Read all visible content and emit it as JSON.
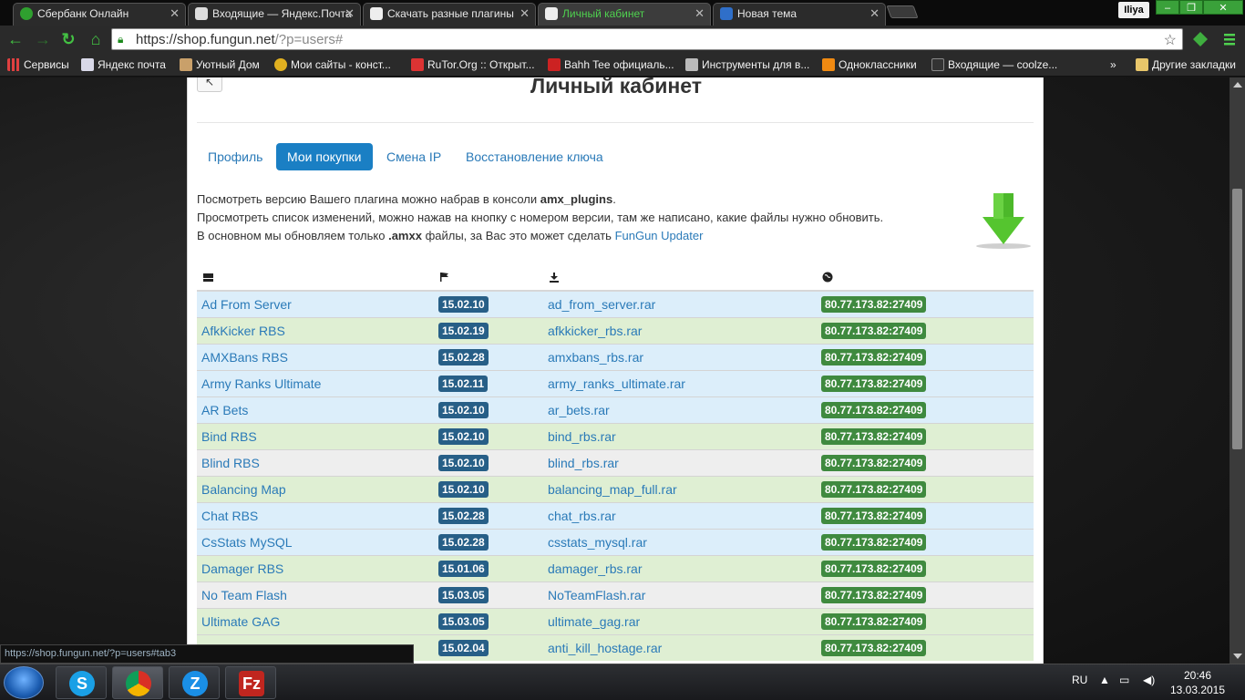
{
  "browser": {
    "tabs": [
      {
        "title": "Сбербанк Онлайн",
        "active": false
      },
      {
        "title": "Входящие — Яндекс.Почта",
        "active": false
      },
      {
        "title": "Скачать разные плагины",
        "active": false
      },
      {
        "title": "Личный кабинет",
        "active": true
      },
      {
        "title": "Новая тема",
        "active": false
      }
    ],
    "user": "Iliya",
    "url_main": "https://shop.fungun.net",
    "url_rest": "/?p=users#",
    "bookmarks": [
      "Сервисы",
      "Яндекс почта",
      "Уютный Дом",
      "Мои сайты - конст...",
      "RuTor.Org :: Открыт...",
      "Bahh Tee официаль...",
      "Инструменты для в...",
      "Одноклассники",
      "Входящие — coolze..."
    ],
    "bookmarks_more": "»",
    "other_bookmarks": "Другие закладки",
    "status_url": "https://shop.fungun.net/?p=users#tab3"
  },
  "page": {
    "title": "Личный кабинет",
    "tabs": [
      "Профиль",
      "Мои покупки",
      "Смена IP",
      "Восстановление ключа"
    ],
    "info": {
      "l1_a": "Посмотреть версию Вашего плагина можно набрав в консоли ",
      "l1_b": "amx_plugins",
      "l1_c": ".",
      "l2": "Просмотреть список изменений, можно нажав на кнопку с номером версии, там же написано, какие файлы нужно обновить.",
      "l3_a": "В основном мы обновляем только ",
      "l3_b": ".amxx",
      "l3_c": " файлы, за Вас это может сделать ",
      "l3_link": "FunGun Updater"
    },
    "table": {
      "header_icons": [
        "server-icon",
        "flag-icon",
        "download-icon",
        "globe-icon"
      ],
      "rows": [
        {
          "name": "Ad From Server",
          "version": "15.02.10",
          "file": "ad_from_server.rar",
          "server": "80.77.173.82:27409",
          "color": "blue"
        },
        {
          "name": "AfkKicker RBS",
          "version": "15.02.19",
          "file": "afkkicker_rbs.rar",
          "server": "80.77.173.82:27409",
          "color": "green"
        },
        {
          "name": "AMXBans RBS",
          "version": "15.02.28",
          "file": "amxbans_rbs.rar",
          "server": "80.77.173.82:27409",
          "color": "blue"
        },
        {
          "name": "Army Ranks Ultimate",
          "version": "15.02.11",
          "file": "army_ranks_ultimate.rar",
          "server": "80.77.173.82:27409",
          "color": "blue"
        },
        {
          "name": "AR Bets",
          "version": "15.02.10",
          "file": "ar_bets.rar",
          "server": "80.77.173.82:27409",
          "color": "blue"
        },
        {
          "name": "Bind RBS",
          "version": "15.02.10",
          "file": "bind_rbs.rar",
          "server": "80.77.173.82:27409",
          "color": "green"
        },
        {
          "name": "Blind RBS",
          "version": "15.02.10",
          "file": "blind_rbs.rar",
          "server": "80.77.173.82:27409",
          "color": "grey"
        },
        {
          "name": "Balancing Map",
          "version": "15.02.10",
          "file": "balancing_map_full.rar",
          "server": "80.77.173.82:27409",
          "color": "green"
        },
        {
          "name": "Chat RBS",
          "version": "15.02.28",
          "file": "chat_rbs.rar",
          "server": "80.77.173.82:27409",
          "color": "blue"
        },
        {
          "name": "CsStats MySQL",
          "version": "15.02.28",
          "file": "csstats_mysql.rar",
          "server": "80.77.173.82:27409",
          "color": "blue"
        },
        {
          "name": "Damager RBS",
          "version": "15.01.06",
          "file": "damager_rbs.rar",
          "server": "80.77.173.82:27409",
          "color": "green"
        },
        {
          "name": "No Team Flash",
          "version": "15.03.05",
          "file": "NoTeamFlash.rar",
          "server": "80.77.173.82:27409",
          "color": "grey"
        },
        {
          "name": "Ultimate GAG",
          "version": "15.03.05",
          "file": "ultimate_gag.rar",
          "server": "80.77.173.82:27409",
          "color": "green"
        },
        {
          "name": "",
          "version": "15.02.04",
          "file": "anti_kill_hostage.rar",
          "server": "80.77.173.82:27409",
          "color": "green"
        }
      ]
    }
  },
  "taskbar": {
    "apps": [
      {
        "name": "skype",
        "letter": "S",
        "color": "#1aa0e6"
      },
      {
        "name": "chrome",
        "letter": "",
        "color": "#e8a500"
      },
      {
        "name": "zona",
        "letter": "Z",
        "color": "#1a8fe6"
      },
      {
        "name": "filezilla",
        "letter": "Fz",
        "color": "#c0261f"
      }
    ],
    "lang": "RU",
    "time": "20:46",
    "date": "13.03.2015"
  }
}
